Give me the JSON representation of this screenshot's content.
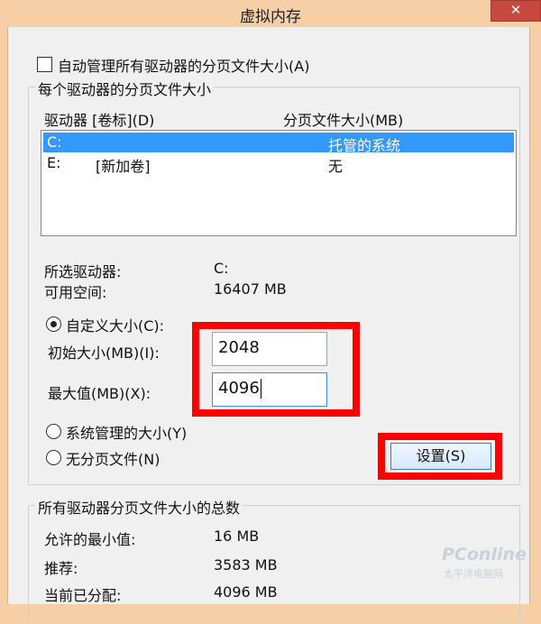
{
  "window": {
    "title": "虚拟内存",
    "close_symbol": "✕"
  },
  "auto_manage": {
    "label": "自动管理所有驱动器的分页文件大小(A)",
    "checked": false
  },
  "per_drive": {
    "group_title": "每个驱动器的分页文件大小",
    "col_drive": "驱动器 [卷标](D)",
    "col_size": "分页文件大小(MB)",
    "drives": [
      {
        "drive": "C:",
        "label": "",
        "size": "托管的系统",
        "selected": true
      },
      {
        "drive": "E:",
        "label": "[新加卷]",
        "size": "无",
        "selected": false
      }
    ],
    "selected_drive_label": "所选驱动器:",
    "selected_drive_value": "C:",
    "free_space_label": "可用空间:",
    "free_space_value": "16407 MB",
    "custom_size_label": "自定义大小(C):",
    "initial_size_label": "初始大小(MB)(I):",
    "initial_size_value": "2048",
    "max_size_label": "最大值(MB)(X):",
    "max_size_value": "4096",
    "system_managed_label": "系统管理的大小(Y)",
    "no_paging_label": "无分页文件(N)",
    "set_button_label": "设置(S)",
    "selected_option": "custom"
  },
  "totals": {
    "group_title": "所有驱动器分页文件大小的总数",
    "min_label": "允许的最小值:",
    "min_value": "16 MB",
    "recommended_label": "推荐:",
    "recommended_value": "3583 MB",
    "current_label": "当前已分配:",
    "current_value": "4096 MB"
  },
  "watermark": {
    "brand": "PConline",
    "subtitle": "太平洋电脑网"
  },
  "colors": {
    "highlight": "#ff0000",
    "selection": "#3399ff",
    "title_bar": "#f7cfa6"
  }
}
